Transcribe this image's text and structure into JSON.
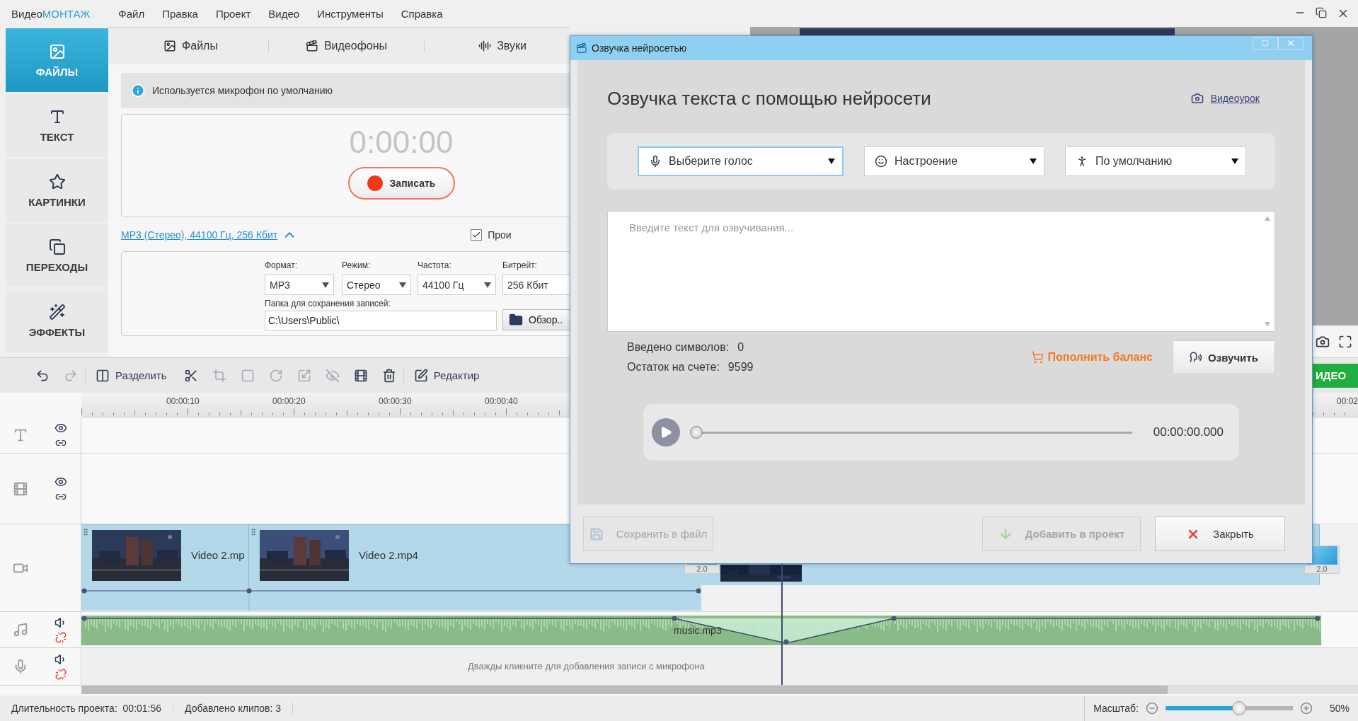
{
  "app": {
    "logo_plain": "Видео",
    "logo_accent": "МОНТАЖ"
  },
  "menu": [
    "Файл",
    "Правка",
    "Проект",
    "Видео",
    "Инструменты",
    "Справка"
  ],
  "sidebar": [
    {
      "label": "ФАЙЛЫ",
      "selected": true
    },
    {
      "label": "ТЕКСТ",
      "selected": false
    },
    {
      "label": "КАРТИНКИ",
      "selected": false
    },
    {
      "label": "ПЕРЕХОДЫ",
      "selected": false
    },
    {
      "label": "ЭФФЕКТЫ",
      "selected": false
    }
  ],
  "source_tabs": [
    "Файлы",
    "Видеофоны",
    "Звуки"
  ],
  "recorder": {
    "notice": "Используется микрофон по умолчанию",
    "timer": "0:00:00",
    "record_button": "Записать",
    "format_link": "MP3 (Стерео), 44100 Гц, 256 Кбит",
    "expanded": true,
    "checkbox": {
      "label": "Прои",
      "checked": true
    },
    "settings": [
      {
        "label": "Формат:",
        "value": "MP3"
      },
      {
        "label": "Режим:",
        "value": "Стерео"
      },
      {
        "label": "Частота:",
        "value": "44100 Гц"
      },
      {
        "label": "Битрейт:",
        "value": "256 Кбит"
      }
    ],
    "folder": {
      "label": "Папка для сохранения записей:",
      "value": "C:\\Users\\Public\\"
    },
    "browse_button": "Обзор.."
  },
  "toolbar": [
    {
      "disabled": false
    },
    {
      "disabled": true
    },
    {
      "label": "Разделить",
      "disabled": false
    },
    {
      "disabled": false
    },
    {
      "disabled": true
    },
    {
      "disabled": true
    },
    {
      "disabled": true
    },
    {
      "disabled": true
    },
    {
      "disabled": true
    },
    {
      "disabled": false
    },
    {
      "disabled": false
    },
    {
      "label": "Редактир",
      "disabled": false
    }
  ],
  "export_button": "ИДЕО",
  "ruler": [
    "00:00:10",
    "00:00:20",
    "00:00:30",
    "00:00:40"
  ],
  "ruler_edge_label": "00:02",
  "tracks": [
    {
      "kind": "text"
    },
    {
      "kind": "overlay"
    },
    {
      "kind": "video"
    },
    {
      "kind": "music"
    },
    {
      "kind": "mic"
    }
  ],
  "video_clips": [
    {
      "label": "Video 2.mp"
    },
    {
      "label": "Video 2.mp4"
    }
  ],
  "transitions": [
    {
      "label": "2.0"
    },
    {
      "label": "2.0"
    }
  ],
  "music_clip": "music.mp3",
  "mic_hint": "Дважды кликните для добавления записи с микрофона",
  "status": {
    "duration_label": "Длительность проекта:",
    "duration": "00:01:56",
    "clips": "Добавлено клипов: 3",
    "zoom_label": "Масштаб:",
    "zoom": {
      "level": 0.58
    },
    "zoom_value": "50%"
  },
  "dialog": {
    "title": "Озвучка нейросетью",
    "heading": "Озвучка текста с помощью нейросети",
    "tutorial_link": "Видеоурок",
    "selects": [
      {
        "label": "Выберите голос",
        "selected": true
      },
      {
        "label": "Настроение",
        "selected": false
      },
      {
        "label": "По умолчанию",
        "selected": false
      }
    ],
    "text_placeholder": "Введите текст для озвучивания...",
    "stats": [
      {
        "label": "Введено символов:",
        "value": "0"
      },
      {
        "label": "Остаток на счете:",
        "value": "9599"
      }
    ],
    "top_up_link": "Пополнить баланс",
    "speak_button": "Озвучить",
    "player": {
      "time": "00:00:00.000",
      "level": 0
    },
    "footer_buttons": [
      {
        "label": "Сохранить в файл",
        "disabled": true
      },
      {
        "label": "Добавить в проект",
        "disabled": true
      },
      {
        "label": "Закрыть",
        "disabled": false
      }
    ]
  }
}
